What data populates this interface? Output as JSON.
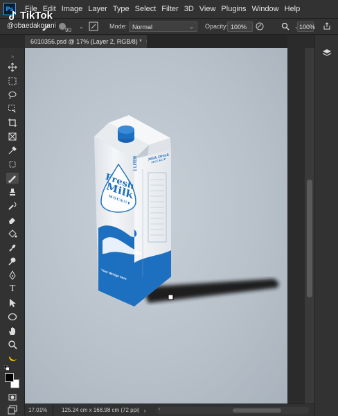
{
  "menu": {
    "logo": "Ps",
    "items": [
      "File",
      "Edit",
      "Image",
      "Layer",
      "Type",
      "Select",
      "Filter",
      "3D",
      "View",
      "Plugins",
      "Window",
      "Help"
    ]
  },
  "options": {
    "brush_size": "90",
    "mode_label": "Mode:",
    "mode_value": "Normal",
    "opacity_label": "Opacity:",
    "opacity_value": "100%",
    "flow_value": "100%"
  },
  "watermark": {
    "brand": "TikTok",
    "handle": "@obaedakorani"
  },
  "document": {
    "tab_title": "6010356.psd @ 17% (Layer 2, RGB/8) *",
    "close": "×"
  },
  "product": {
    "brand_line1": "Fresh",
    "brand_line2": "Milk",
    "subtitle": "MOCKUP",
    "volume": "1 LITER",
    "side_title": "Milk Drink",
    "side_sub": "MOCKUP",
    "tagline": "Your design here"
  },
  "status": {
    "zoom": "17.01%",
    "doc_size": "125.24 cm x 168.98 cm (72 ppi)"
  },
  "colors": {
    "accent_blue": "#1d6fbf",
    "canvas_bg": "#bcc4cc",
    "ui_dark": "#323232"
  }
}
